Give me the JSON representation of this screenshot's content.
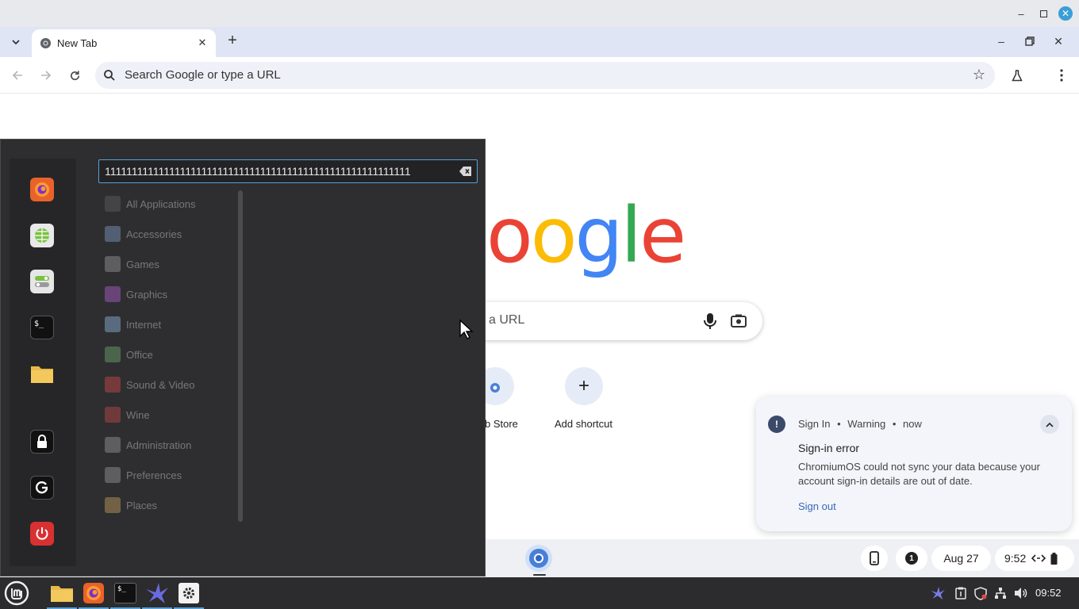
{
  "browser": {
    "tab_title": "New Tab",
    "omnibox_placeholder": "Search Google or type a URL"
  },
  "ntp": {
    "logo_text": "oogle",
    "search_placeholder": "a URL",
    "shortcuts": [
      {
        "label": "b Store"
      },
      {
        "label": "Add shortcut"
      }
    ]
  },
  "notification": {
    "source": "Sign In",
    "severity": "Warning",
    "time": "now",
    "title": "Sign-in error",
    "body": "ChromiumOS could not sync your data because your account sign-in details are out of date.",
    "action": "Sign out"
  },
  "cros_shelf": {
    "notification_count": "1",
    "date": "Aug 27",
    "time": "9:52"
  },
  "mint_menu": {
    "search_value": "111111111111111111111111111111111111111111111111111111111",
    "favorites": [
      "firefox",
      "web-browser",
      "settings-toggles",
      "terminal",
      "files",
      "lock-screen",
      "logout",
      "power"
    ],
    "categories": [
      {
        "label": "All Applications",
        "color": "#5f5f5f"
      },
      {
        "label": "Accessories",
        "color": "#7f9cc6"
      },
      {
        "label": "Games",
        "color": "#9a9a9a"
      },
      {
        "label": "Graphics",
        "color": "#b060d0"
      },
      {
        "label": "Internet",
        "color": "#8fb8e0"
      },
      {
        "label": "Office",
        "color": "#6fa86f"
      },
      {
        "label": "Sound & Video",
        "color": "#d04a4a"
      },
      {
        "label": "Wine",
        "color": "#c04a4a"
      },
      {
        "label": "Administration",
        "color": "#9a9a9a"
      },
      {
        "label": "Preferences",
        "color": "#9a9a9a"
      },
      {
        "label": "Places",
        "color": "#c8a060"
      }
    ]
  },
  "panel": {
    "clock": "09:52"
  },
  "colors": {
    "accent": "#5aa0d6",
    "menu_bg": "#2e2e30",
    "panel_bg": "#2c2c2e"
  }
}
